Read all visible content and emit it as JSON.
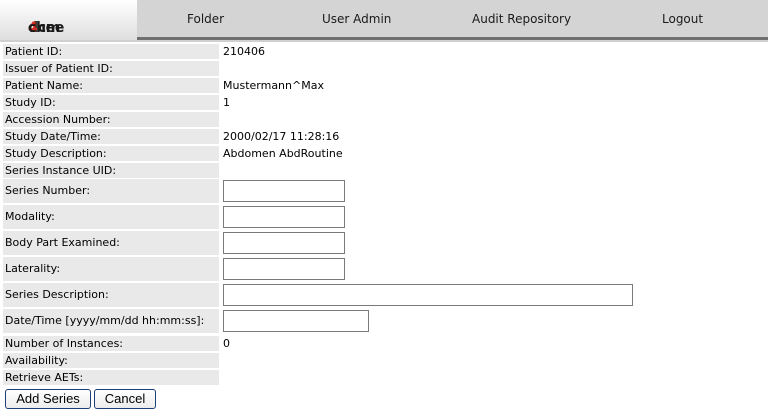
{
  "app": {
    "logo_text_a": "dcm",
    "logo_text_b": "4",
    "logo_text_c": "chee"
  },
  "nav": {
    "folder": "Folder",
    "user_admin": "User Admin",
    "audit_repository": "Audit Repository",
    "logout": "Logout"
  },
  "fields": {
    "patient_id": {
      "label": "Patient ID:",
      "value": "210406"
    },
    "issuer": {
      "label": "Issuer of Patient ID:",
      "value": ""
    },
    "patient_name": {
      "label": "Patient Name:",
      "value": "Mustermann^Max"
    },
    "study_id": {
      "label": "Study ID:",
      "value": "1"
    },
    "accession": {
      "label": "Accession Number:",
      "value": ""
    },
    "study_datetime": {
      "label": "Study Date/Time:",
      "value": "2000/02/17 11:28:16"
    },
    "study_description": {
      "label": "Study Description:",
      "value": "Abdomen AbdRoutine"
    },
    "series_uid": {
      "label": "Series Instance UID:",
      "value": ""
    },
    "series_number": {
      "label": "Series Number:",
      "value": ""
    },
    "modality": {
      "label": "Modality:",
      "value": ""
    },
    "body_part": {
      "label": "Body Part Examined:",
      "value": ""
    },
    "laterality": {
      "label": "Laterality:",
      "value": ""
    },
    "series_description": {
      "label": "Series Description:",
      "value": ""
    },
    "series_datetime": {
      "label": "Date/Time [yyyy/mm/dd hh:mm:ss]:",
      "value": ""
    },
    "num_instances": {
      "label": "Number of Instances:",
      "value": "0"
    },
    "availability": {
      "label": "Availability:",
      "value": ""
    },
    "retrieve_aets": {
      "label": "Retrieve AETs:",
      "value": ""
    }
  },
  "buttons": {
    "add_series": "Add Series",
    "cancel": "Cancel"
  }
}
